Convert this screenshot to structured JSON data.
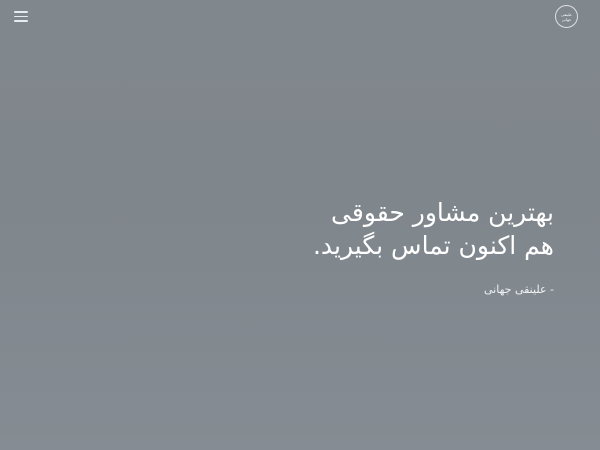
{
  "header": {
    "menu_icon": "hamburger-menu-icon",
    "logo": {
      "line1": "علینقی",
      "line2": "جهانی"
    }
  },
  "hero": {
    "title_line1": "بهترین مشاور حقوقی",
    "title_line2": "هم اکنون تماس بگیرید.",
    "author": "- علینقی جهانی"
  },
  "colors": {
    "background": "#80878d",
    "text": "#ffffff"
  }
}
